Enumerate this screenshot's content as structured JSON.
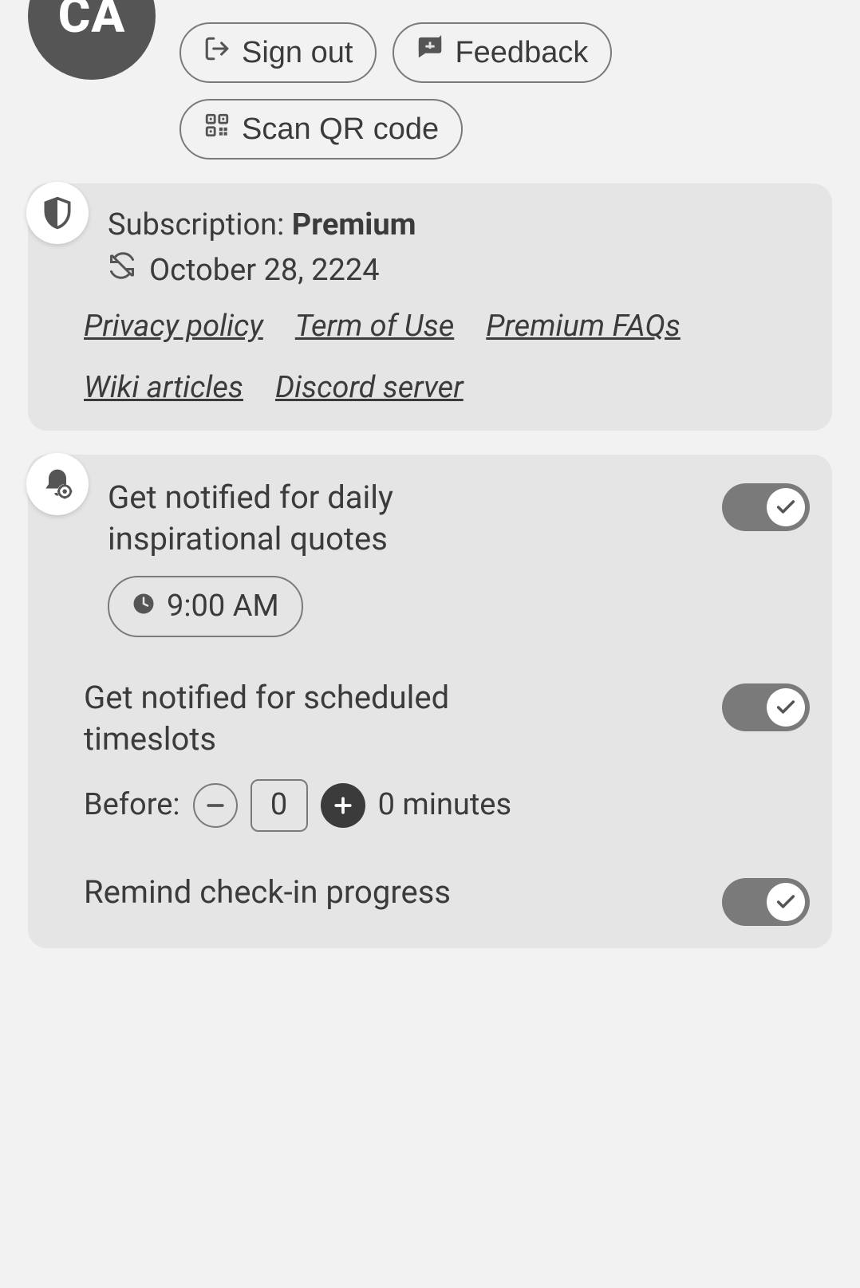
{
  "header": {
    "avatar_initials": "CA",
    "buttons": {
      "signout": "Sign out",
      "feedback": "Feedback",
      "scanqr": "Scan QR code"
    }
  },
  "subscription": {
    "label": "Subscription: ",
    "tier": "Premium",
    "date": "October 28, 2224",
    "links": {
      "privacy": " Privacy policy",
      "terms": " Term of Use",
      "faqs": " Premium FAQs",
      "wiki": " Wiki articles",
      "discord": " Discord server"
    }
  },
  "notifications": {
    "quotes": {
      "label": "Get notified for daily inspirational quotes",
      "time": "9:00 AM",
      "enabled": true
    },
    "timeslots": {
      "label": "Get notified for scheduled timeslots",
      "before_label": "Before:",
      "before_value": "0",
      "summary": "0 minutes",
      "enabled": true
    },
    "checkin": {
      "label": "Remind check-in progress",
      "enabled": true
    }
  }
}
